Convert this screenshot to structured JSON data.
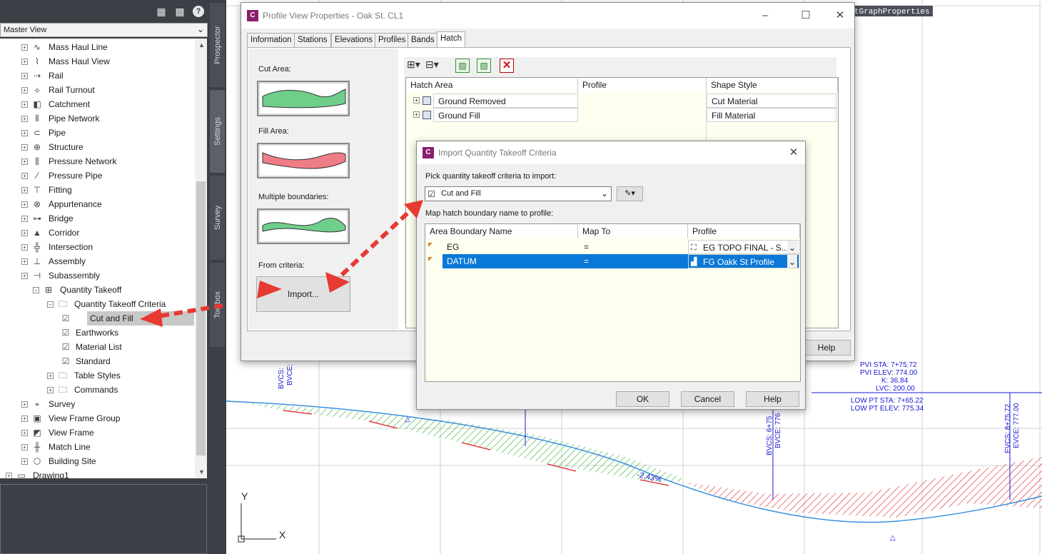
{
  "toolspace": {
    "view": "Master View",
    "side_tabs": [
      "Prospector",
      "Settings",
      "Survey",
      "Toolbox"
    ],
    "tree": [
      {
        "label": "Mass Haul Line",
        "icon": "line-icon"
      },
      {
        "label": "Mass Haul View",
        "icon": "chart-icon"
      },
      {
        "label": "Rail",
        "icon": "rail-icon"
      },
      {
        "label": "Rail Turnout",
        "icon": "turnout-icon"
      },
      {
        "label": "Catchment",
        "icon": "catchment-icon"
      },
      {
        "label": "Pipe Network",
        "icon": "pipe-network-icon"
      },
      {
        "label": "Pipe",
        "icon": "pipe-icon"
      },
      {
        "label": "Structure",
        "icon": "structure-icon"
      },
      {
        "label": "Pressure Network",
        "icon": "pressure-network-icon"
      },
      {
        "label": "Pressure Pipe",
        "icon": "pressure-pipe-icon"
      },
      {
        "label": "Fitting",
        "icon": "fitting-icon"
      },
      {
        "label": "Appurtenance",
        "icon": "appurtenance-icon"
      },
      {
        "label": "Bridge",
        "icon": "bridge-icon"
      },
      {
        "label": "Corridor",
        "icon": "corridor-icon"
      },
      {
        "label": "Intersection",
        "icon": "intersection-icon"
      },
      {
        "label": "Assembly",
        "icon": "assembly-icon"
      },
      {
        "label": "Subassembly",
        "icon": "subassembly-icon"
      },
      {
        "label": "Quantity Takeoff",
        "icon": "quantity-takeoff-icon"
      },
      {
        "label": "Quantity Takeoff Criteria",
        "icon": "folder-icon"
      },
      {
        "label": "Cut and Fill",
        "icon": "criteria-icon"
      },
      {
        "label": "Earthworks",
        "icon": "criteria-icon"
      },
      {
        "label": "Material List",
        "icon": "criteria-icon"
      },
      {
        "label": "Standard",
        "icon": "criteria-icon"
      },
      {
        "label": "Table Styles",
        "icon": "folder-icon"
      },
      {
        "label": "Commands",
        "icon": "folder-icon"
      },
      {
        "label": "Survey",
        "icon": "survey-icon"
      },
      {
        "label": "View Frame Group",
        "icon": "view-frame-group-icon"
      },
      {
        "label": "View Frame",
        "icon": "view-frame-icon"
      },
      {
        "label": "Match Line",
        "icon": "match-line-icon"
      },
      {
        "label": "Building Site",
        "icon": "building-site-icon"
      },
      {
        "label": "Drawing1",
        "icon": "drawing-icon"
      }
    ]
  },
  "profile_dialog": {
    "title": "Profile View Properties - Oak St. CL1",
    "tabs": [
      "Information",
      "Stations",
      "Elevations",
      "Profiles",
      "Bands",
      "Hatch"
    ],
    "cut_area": "Cut Area:",
    "fill_area": "Fill Area:",
    "multiple": "Multiple boundaries:",
    "from_criteria": "From criteria:",
    "import_btn": "Import...",
    "cols": [
      "Hatch Area",
      "Profile",
      "Shape Style"
    ],
    "rows": [
      {
        "area": "Ground Removed",
        "profile": "",
        "style": "Cut Material"
      },
      {
        "area": "Ground Fill",
        "profile": "",
        "style": "Fill Material"
      }
    ],
    "help": "Help"
  },
  "import_dialog": {
    "title": "Import Quantity Takeoff Criteria",
    "pick_label": "Pick quantity takeoff criteria to import:",
    "criteria": "Cut and Fill",
    "map_label": "Map hatch boundary name to profile:",
    "cols": [
      "Area Boundary Name",
      "Map To",
      "Profile"
    ],
    "rows": [
      {
        "name": "EG",
        "map": "=",
        "profile": "EG TOPO FINAL - S..."
      },
      {
        "name": "DATUM",
        "map": "=",
        "profile": "FG Oakk St Profile"
      }
    ],
    "ok": "OK",
    "cancel": "Cancel",
    "help": "Help"
  },
  "drawing": {
    "cmd_tip": "tGraphProperties",
    "pvi_labels": [
      "PVI STA: 7+75.72",
      "PVI ELEV: 774.00",
      "K: 36.84",
      "LVC: 200.00"
    ],
    "low_labels": [
      "LOW PT STA: 7+65.22",
      "LOW PT ELEV: 775.34"
    ],
    "grade": "-2.43%",
    "bvc_left": [
      "BVCS:",
      "BVCE:"
    ],
    "bvc_mid": [
      "BVCS: 6+75",
      "BVCE: 776"
    ],
    "evc": [
      "EVCS: 8+75.72",
      "EVCE: 777.00"
    ],
    "axis_y": "Y",
    "axis_x": "X"
  }
}
